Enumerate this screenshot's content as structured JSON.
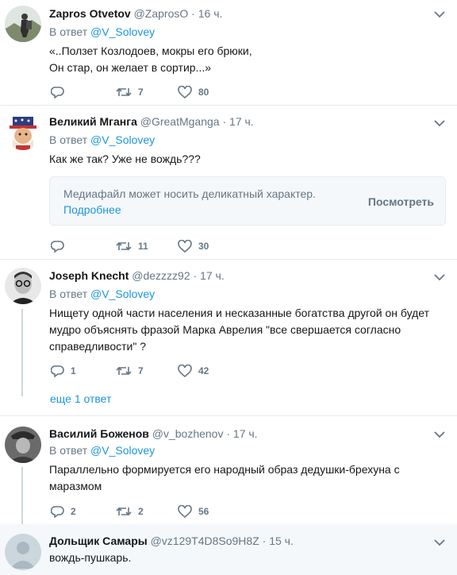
{
  "reply_prefix": "В ответ",
  "tweets": [
    {
      "name": "Zapros Otvetov",
      "handle": "@ZaprosO",
      "time": "16 ч.",
      "reply_to": "@V_Solovey",
      "text_lines": [
        "«..Ползет Козлодоев, мокры его брюки,",
        "Он стар, он желает в сортир...»"
      ],
      "replies": "",
      "retweets": "7",
      "likes": "80"
    },
    {
      "name": "Великий Мганга",
      "handle": "@GreatMganga",
      "time": "17 ч.",
      "reply_to": "@V_Solovey",
      "text_lines": [
        "Как же так? Уже не вождь???"
      ],
      "media_warning": {
        "message": "Медиафайл может носить деликатный характер.",
        "learn_more": "Подробнее",
        "view_button": "Посмотреть"
      },
      "replies": "",
      "retweets": "11",
      "likes": "30"
    },
    {
      "name": "Joseph Knecht",
      "handle": "@dezzzz92",
      "time": "17 ч.",
      "reply_to": "@V_Solovey",
      "text_lines": [
        "Нищету одной части населения и несказанные богатства другой он будет",
        "мудро объяснять фразой Марка Аврелия \"все свершается согласно",
        "справедливости\" ?"
      ],
      "replies": "1",
      "retweets": "7",
      "likes": "42",
      "more_replies": "еще 1 ответ"
    },
    {
      "name": "Василий Боженов",
      "handle": "@v_bozhenov",
      "time": "17 ч.",
      "reply_to": "@V_Solovey",
      "text_lines": [
        "Параллельно формируется его народный образ дедушки-брехуна с",
        "маразмом"
      ],
      "replies": "2",
      "retweets": "2",
      "likes": "56"
    },
    {
      "name": "Дольщик Самары",
      "handle": "@vz129T4D8So9H8Z",
      "time": "15 ч.",
      "text_lines": [
        "вождь-пушкарь."
      ]
    }
  ],
  "colors": {
    "link": "#1b95e0",
    "muted": "#657786",
    "text": "#14171a",
    "border": "#e6ecf0",
    "thread_line": "#ccd6dd"
  },
  "icons": [
    "reply-icon",
    "retweet-icon",
    "like-icon",
    "chevron-down-icon"
  ]
}
